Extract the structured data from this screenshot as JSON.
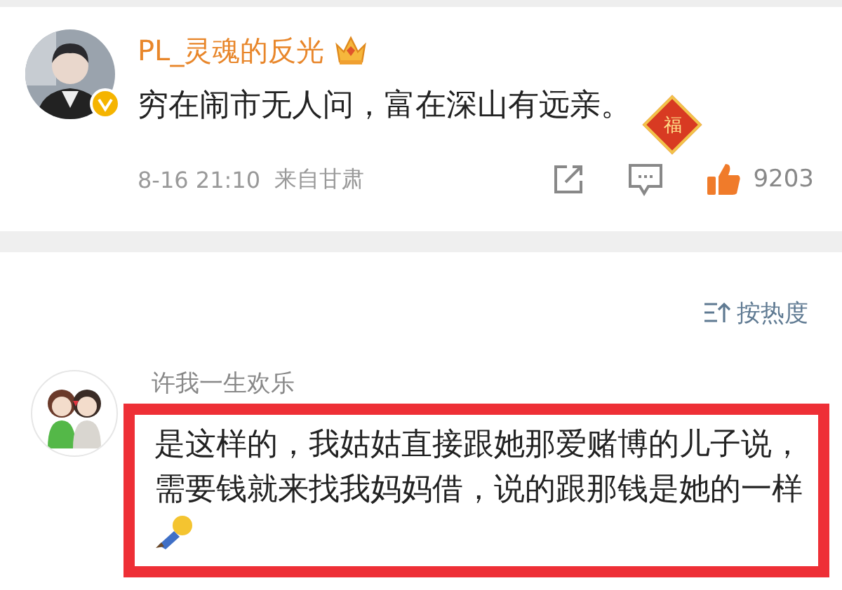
{
  "post": {
    "author": "PL_灵魂的反光",
    "verified": true,
    "text": "穷在闹市无人问，富在深山有远亲。",
    "sticker": "福",
    "time": "8-16 21:10",
    "location": "来自甘肃",
    "likes": "9203"
  },
  "sort": {
    "label": "按热度"
  },
  "comment": {
    "author": "许我一生欢乐",
    "text": "是这样的，我姑姑直接跟她那爱赌博的儿子说，需要钱就来找我妈妈借，说的跟那钱是她的一样",
    "highlighted": true
  }
}
